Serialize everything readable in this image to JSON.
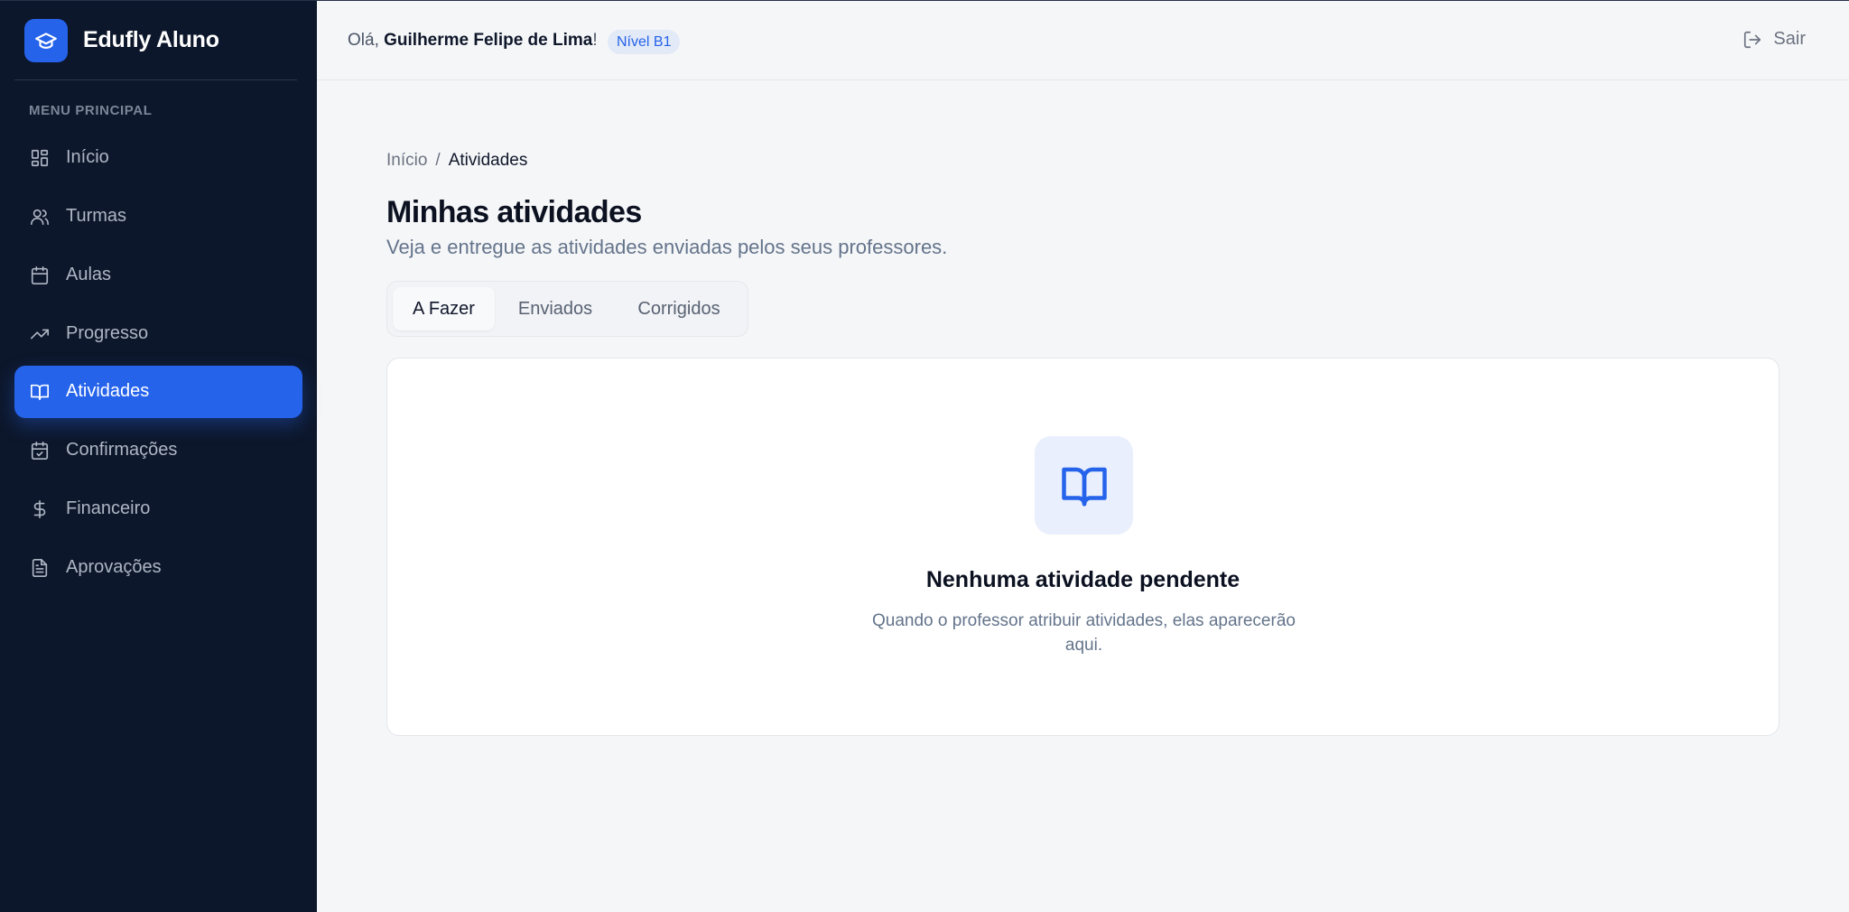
{
  "brand": {
    "name": "Edufly Aluno",
    "logo_icon": "graduation-cap-icon",
    "accent": "#2563eb"
  },
  "sidebar": {
    "section_title": "MENU PRINCIPAL",
    "items": [
      {
        "label": "Início",
        "icon": "dashboard-grid-icon",
        "active": false
      },
      {
        "label": "Turmas",
        "icon": "users-icon",
        "active": false
      },
      {
        "label": "Aulas",
        "icon": "calendar-icon",
        "active": false
      },
      {
        "label": "Progresso",
        "icon": "trending-up-icon",
        "active": false
      },
      {
        "label": "Atividades",
        "icon": "book-open-icon",
        "active": true
      },
      {
        "label": "Confirmações",
        "icon": "calendar-check-icon",
        "active": false
      },
      {
        "label": "Financeiro",
        "icon": "dollar-sign-icon",
        "active": false
      },
      {
        "label": "Aprovações",
        "icon": "file-text-icon",
        "active": false
      }
    ]
  },
  "header": {
    "greeting_prefix": "Olá, ",
    "user_name": "Guilherme Felipe de Lima",
    "greeting_suffix": "!",
    "level_badge": "Nível B1",
    "logout_label": "Sair",
    "logout_icon": "log-out-icon"
  },
  "breadcrumb": {
    "home": "Início",
    "separator": "/",
    "current": "Atividades"
  },
  "page": {
    "title": "Minhas atividades",
    "subtitle": "Veja e entregue as atividades enviadas pelos seus professores."
  },
  "tabs": [
    {
      "label": "A Fazer",
      "active": true
    },
    {
      "label": "Enviados",
      "active": false
    },
    {
      "label": "Corrigidos",
      "active": false
    }
  ],
  "empty_state": {
    "icon": "book-open-icon",
    "title": "Nenhuma atividade pendente",
    "text": "Quando o professor atribuir atividades, elas aparecerão aqui."
  }
}
